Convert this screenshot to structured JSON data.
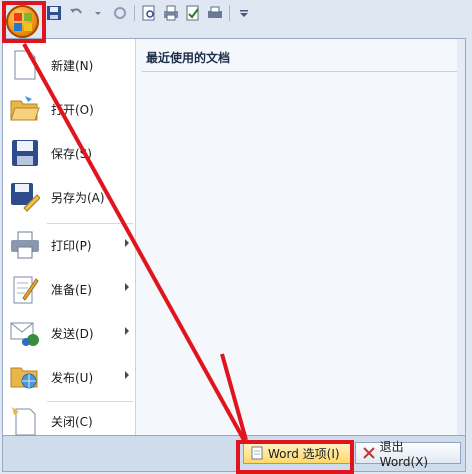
{
  "title_bar": {
    "quick_access": [
      "save-icon",
      "undo-icon",
      "redo-icon",
      "print-preview-icon",
      "print-icon",
      "spelling-icon",
      "customize-icon"
    ]
  },
  "menu": {
    "items": [
      {
        "label": "新建(N)",
        "icon": "new-document-icon",
        "has_submenu": false
      },
      {
        "label": "打开(O)",
        "icon": "open-folder-icon",
        "has_submenu": false
      },
      {
        "label": "保存(S)",
        "icon": "save-icon",
        "has_submenu": false
      },
      {
        "label": "另存为(A)",
        "icon": "save-as-icon",
        "has_submenu": false
      },
      {
        "label": "打印(P)",
        "icon": "print-icon",
        "has_submenu": true
      },
      {
        "label": "准备(E)",
        "icon": "prepare-icon",
        "has_submenu": true
      },
      {
        "label": "发送(D)",
        "icon": "send-icon",
        "has_submenu": true
      },
      {
        "label": "发布(U)",
        "icon": "publish-icon",
        "has_submenu": true
      },
      {
        "label": "关闭(C)",
        "icon": "close-document-icon",
        "has_submenu": false
      }
    ],
    "recent_title": "最近使用的文档"
  },
  "bottom": {
    "options_button": "Word 选项(I)",
    "exit_button": "退出 Word(X)"
  },
  "colors": {
    "highlight_red": "#e0141c",
    "orb_orange": "#f39a1c"
  }
}
